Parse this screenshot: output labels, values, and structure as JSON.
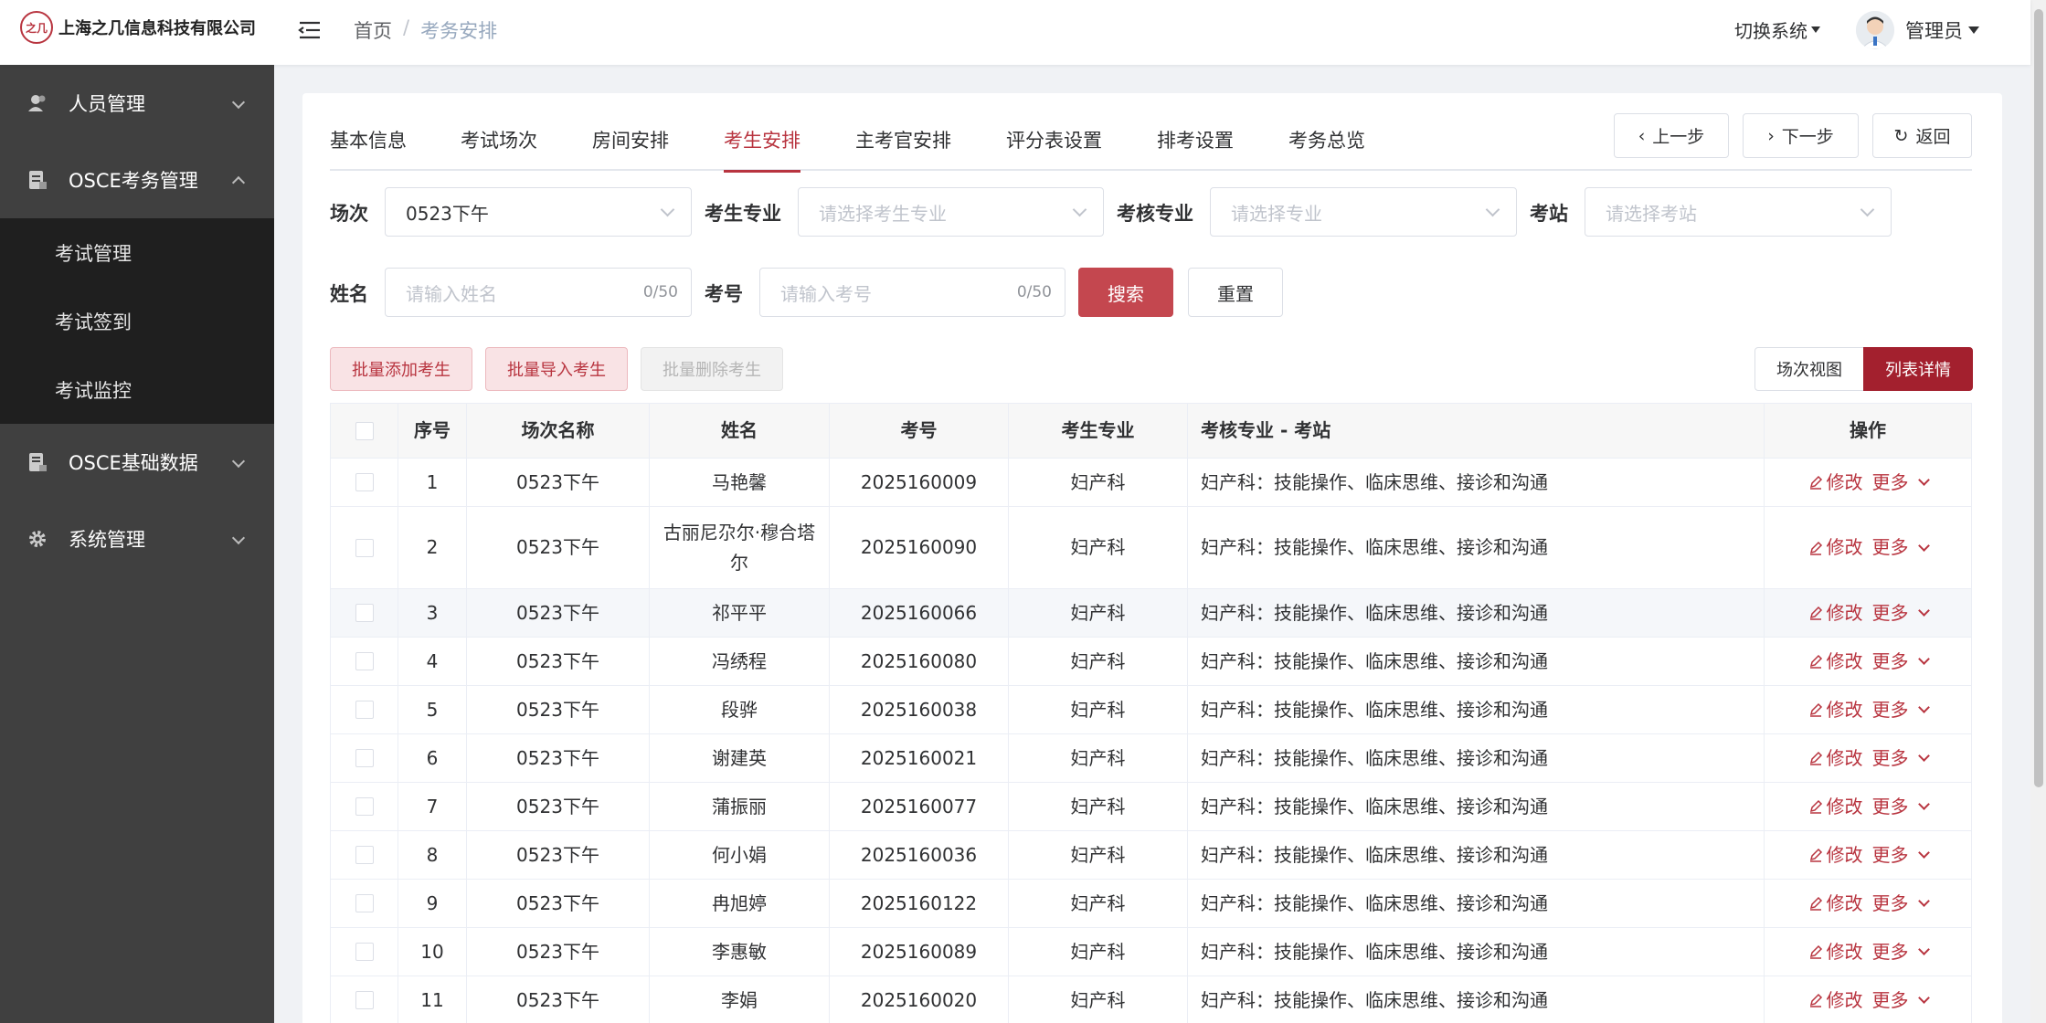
{
  "app": {
    "company": "上海之几信息科技有限公司",
    "logo_mark": "之几"
  },
  "breadcrumb": [
    "首页",
    "考务安排"
  ],
  "breadcrumb_sep": "/",
  "header": {
    "switch_system": "切换系统",
    "user_name": "管理员"
  },
  "sidebar": {
    "items": [
      {
        "label": "人员管理",
        "icon": "user-icon",
        "expanded": false
      },
      {
        "label": "OSCE考务管理",
        "icon": "document-icon",
        "expanded": true
      },
      {
        "label": "OSCE基础数据",
        "icon": "database-icon",
        "expanded": false
      },
      {
        "label": "系统管理",
        "icon": "gear-icon",
        "expanded": false
      }
    ],
    "sub_items": [
      "考试管理",
      "考试签到",
      "考试监控"
    ]
  },
  "tabs": [
    "基本信息",
    "考试场次",
    "房间安排",
    "考生安排",
    "主考官安排",
    "评分表设置",
    "排考设置",
    "考务总览"
  ],
  "active_tab": "考生安排",
  "nav_buttons": {
    "prev": "上一步",
    "next": "下一步",
    "back": "返回"
  },
  "filters": {
    "session_label": "场次",
    "session_value": "0523下午",
    "student_major_label": "考生专业",
    "student_major_placeholder": "请选择考生专业",
    "assess_major_label": "考核专业",
    "assess_major_placeholder": "请选择专业",
    "station_label": "考站",
    "station_placeholder": "请选择考站",
    "name_label": "姓名",
    "name_placeholder": "请输入姓名",
    "name_count": "0/50",
    "number_label": "考号",
    "number_placeholder": "请输入考号",
    "number_count": "0/50",
    "search": "搜索",
    "reset": "重置"
  },
  "actions": {
    "batch_add": "批量添加考生",
    "batch_import": "批量导入考生",
    "batch_delete": "批量删除考生",
    "session_view": "场次视图",
    "list_detail": "列表详情"
  },
  "table": {
    "columns": [
      "序号",
      "场次名称",
      "姓名",
      "考号",
      "考生专业",
      "考核专业 - 考站",
      "操作"
    ],
    "edit_label": "修改",
    "more_label": "更多",
    "rows": [
      {
        "no": "1",
        "session": "0523下午",
        "name": "马艳馨",
        "number": "2025160009",
        "major": "妇产科",
        "assess": "妇产科：技能操作、临床思维、接诊和沟通"
      },
      {
        "no": "2",
        "session": "0523下午",
        "name": "古丽尼尕尔·穆合塔尔",
        "number": "2025160090",
        "major": "妇产科",
        "assess": "妇产科：技能操作、临床思维、接诊和沟通"
      },
      {
        "no": "3",
        "session": "0523下午",
        "name": "祁平平",
        "number": "2025160066",
        "major": "妇产科",
        "assess": "妇产科：技能操作、临床思维、接诊和沟通"
      },
      {
        "no": "4",
        "session": "0523下午",
        "name": "冯绣程",
        "number": "2025160080",
        "major": "妇产科",
        "assess": "妇产科：技能操作、临床思维、接诊和沟通"
      },
      {
        "no": "5",
        "session": "0523下午",
        "name": "段骅",
        "number": "2025160038",
        "major": "妇产科",
        "assess": "妇产科：技能操作、临床思维、接诊和沟通"
      },
      {
        "no": "6",
        "session": "0523下午",
        "name": "谢建英",
        "number": "2025160021",
        "major": "妇产科",
        "assess": "妇产科：技能操作、临床思维、接诊和沟通"
      },
      {
        "no": "7",
        "session": "0523下午",
        "name": "蒲振丽",
        "number": "2025160077",
        "major": "妇产科",
        "assess": "妇产科：技能操作、临床思维、接诊和沟通"
      },
      {
        "no": "8",
        "session": "0523下午",
        "name": "何小娟",
        "number": "2025160036",
        "major": "妇产科",
        "assess": "妇产科：技能操作、临床思维、接诊和沟通"
      },
      {
        "no": "9",
        "session": "0523下午",
        "name": "冉旭婷",
        "number": "2025160122",
        "major": "妇产科",
        "assess": "妇产科：技能操作、临床思维、接诊和沟通"
      },
      {
        "no": "10",
        "session": "0523下午",
        "name": "李惠敏",
        "number": "2025160089",
        "major": "妇产科",
        "assess": "妇产科：技能操作、临床思维、接诊和沟通"
      },
      {
        "no": "11",
        "session": "0523下午",
        "name": "李娟",
        "number": "2025160020",
        "major": "妇产科",
        "assess": "妇产科：技能操作、临床思维、接诊和沟通"
      }
    ]
  },
  "colors": {
    "accent": "#b8343f",
    "primary_button": "#c4474f",
    "sidebar_bg": "#404040",
    "submenu_bg": "#1f1f1f"
  }
}
